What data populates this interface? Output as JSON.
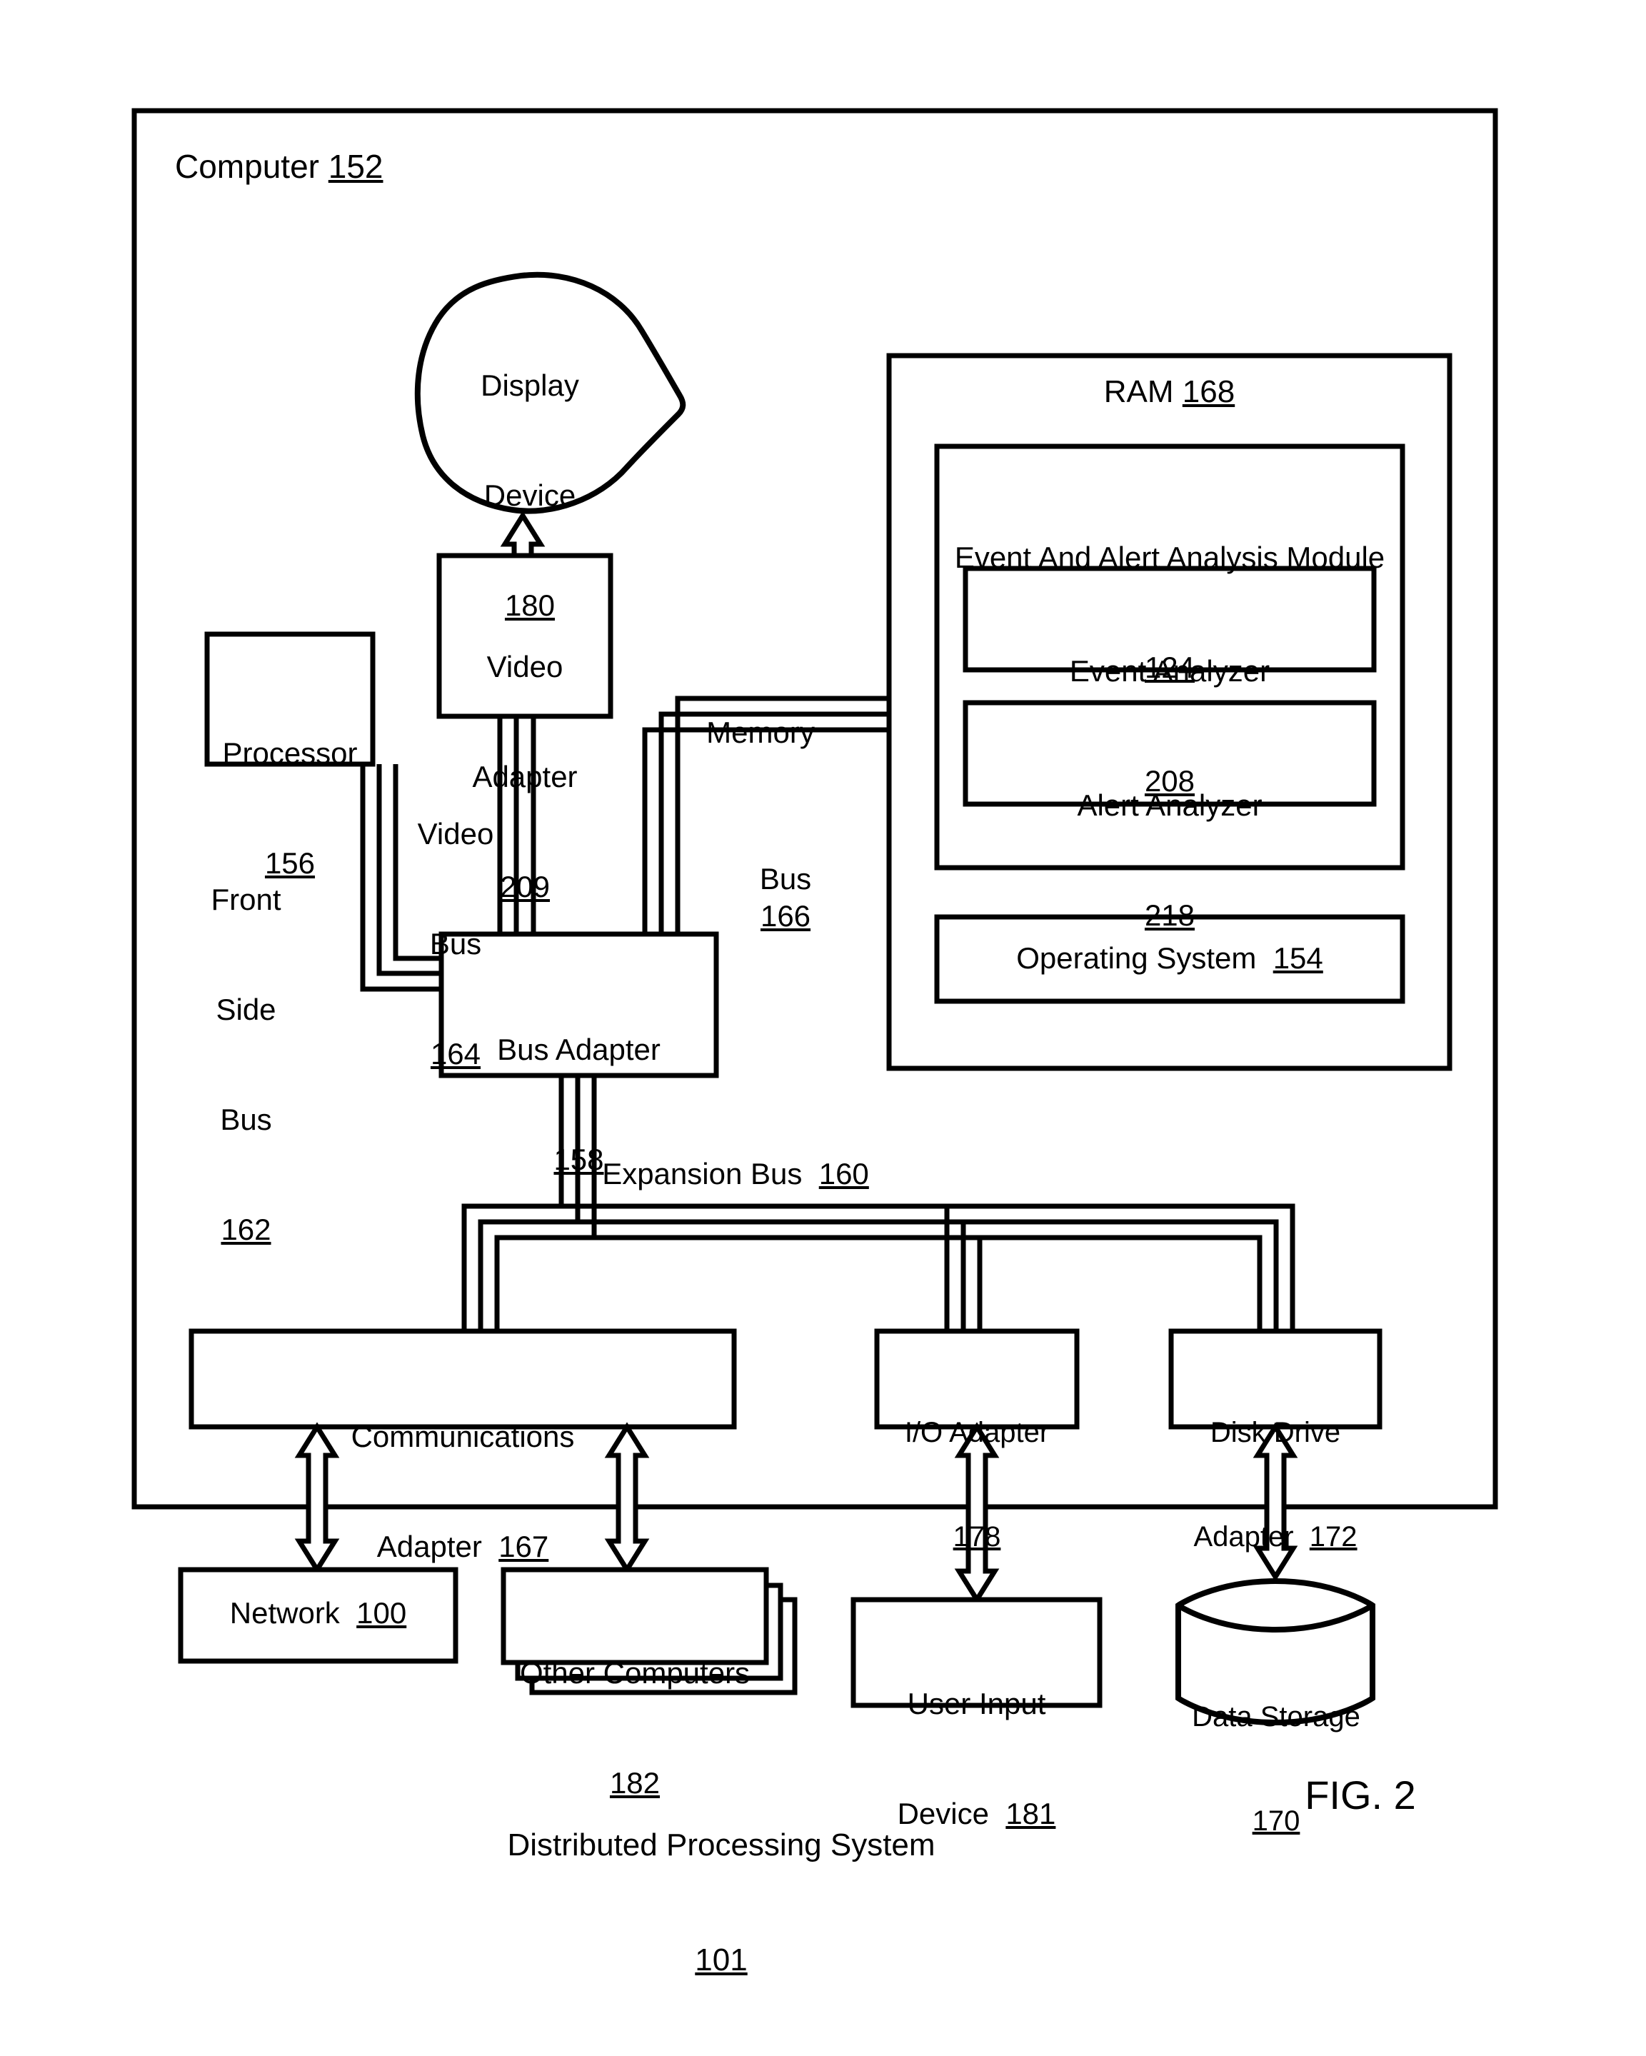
{
  "figure": {
    "label": "FIG. 2",
    "caption_title": "Distributed Processing System",
    "caption_ref": "101"
  },
  "computer": {
    "label": "Computer",
    "ref": "152"
  },
  "display_device": {
    "line1": "Display",
    "line2": "Device",
    "ref": "180"
  },
  "video_adapter": {
    "line1": "Video",
    "line2": "Adapter",
    "ref": "209"
  },
  "processor": {
    "label": "Processor",
    "ref": "156"
  },
  "bus_adapter": {
    "label": "Bus Adapter",
    "ref": "158"
  },
  "buses": {
    "front_side": {
      "l1": "Front",
      "l2": "Side",
      "l3": "Bus",
      "ref": "162"
    },
    "video": {
      "l1": "Video",
      "l2": "Bus",
      "ref": "164"
    },
    "memory": {
      "l1": "Memory",
      "l2": "Bus",
      "ref": "166"
    },
    "expansion": {
      "label": "Expansion Bus",
      "ref": "160"
    }
  },
  "ram": {
    "label": "RAM",
    "ref": "168",
    "module": {
      "label": "Event And Alert Analysis Module",
      "ref": "124",
      "children": [
        {
          "label": "Event Analyzer",
          "ref": "208"
        },
        {
          "label": "Alert Analyzer",
          "ref": "218"
        }
      ]
    },
    "operating_system": {
      "label": "Operating System",
      "ref": "154"
    }
  },
  "adapters": [
    {
      "line1": "Communications",
      "line2": "Adapter",
      "ref": "167"
    },
    {
      "line1": "I/O Adapter",
      "line2": "",
      "ref": "178"
    },
    {
      "line1": "Disk Drive",
      "line2": "Adapter",
      "ref": "172"
    }
  ],
  "peripherals": {
    "network": {
      "label": "Network",
      "ref": "100"
    },
    "other_computers": {
      "label": "Other Computers",
      "ref": "182"
    },
    "user_input": {
      "line1": "User Input",
      "line2": "Device",
      "ref": "181"
    },
    "data_storage": {
      "label": "Data Storage",
      "ref": "170"
    }
  },
  "colors": {
    "stroke": "#000000",
    "fill": "#ffffff"
  }
}
